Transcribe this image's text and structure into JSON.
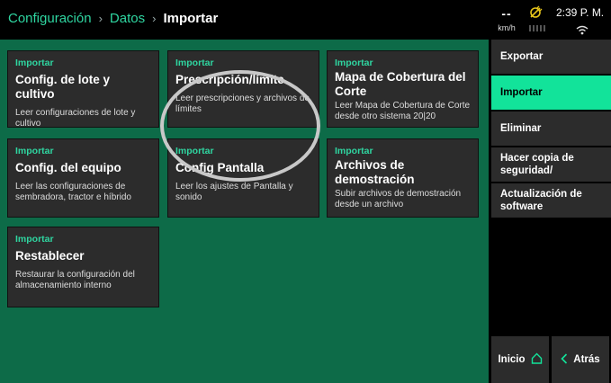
{
  "breadcrumb": {
    "items": [
      "Configuración",
      "Datos"
    ],
    "current": "Importar",
    "separator": "›"
  },
  "status": {
    "speed_value": "--",
    "speed_unit": "km/h",
    "time": "2:39 P. M.",
    "icons": [
      "gps-icon",
      "wifi-icon"
    ]
  },
  "tiles": [
    {
      "category": "Importar",
      "title": "Config. de lote y cultivo",
      "description": "Leer configuraciones de lote y cultivo"
    },
    {
      "category": "Importar",
      "title": "Prescripción/límite",
      "description": "Leer prescripciones y archivos de límites"
    },
    {
      "category": "Importar",
      "title": "Mapa de Cobertura del Corte",
      "description": "Leer Mapa de Cobertura de Corte desde otro sistema 20|20"
    },
    {
      "category": "Importar",
      "title": "Config. del equipo",
      "description": "Leer las configuraciones de sembradora, tractor e híbrido"
    },
    {
      "category": "Importar",
      "title": "Config Pantalla",
      "description": "Leer los ajustes de Pantalla y sonido"
    },
    {
      "category": "Importar",
      "title": "Archivos de demostración",
      "description": "Subir archivos de demostración desde un archivo"
    },
    {
      "category": "Importar",
      "title": "Restablecer",
      "description": "Restaurar la configuración del almacenamiento interno"
    }
  ],
  "sidebar": {
    "items": [
      {
        "label": "Exportar",
        "active": false
      },
      {
        "label": "Importar",
        "active": true
      },
      {
        "label": "Eliminar",
        "active": false
      },
      {
        "label": "Hacer copia de seguridad/",
        "active": false
      },
      {
        "label": "Actualización de software",
        "active": false
      }
    ],
    "home_label": "Inicio",
    "back_label": "Atrás"
  },
  "colors": {
    "accent": "#12e39a",
    "link": "#2fd6a1",
    "panel": "#0d6b48",
    "tile": "#2c2c2c",
    "gps_icon": "#e8c61a"
  }
}
